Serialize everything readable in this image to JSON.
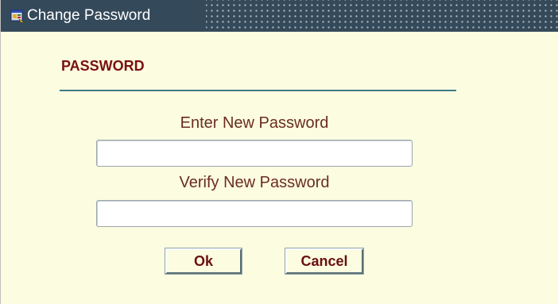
{
  "window": {
    "title": "Change Password",
    "icon": "app-window-icon"
  },
  "form": {
    "section_heading": "PASSWORD",
    "new_password": {
      "label": "Enter New Password",
      "value": "",
      "placeholder": ""
    },
    "verify_password": {
      "label": "Verify New Password",
      "value": "",
      "placeholder": ""
    }
  },
  "buttons": {
    "ok_label": "Ok",
    "cancel_label": "Cancel"
  },
  "colors": {
    "background": "#fcfce1",
    "titlebar": "#34495a",
    "heading": "#7a1111",
    "rule": "#3f7b85",
    "label_text": "#6b2d20"
  }
}
